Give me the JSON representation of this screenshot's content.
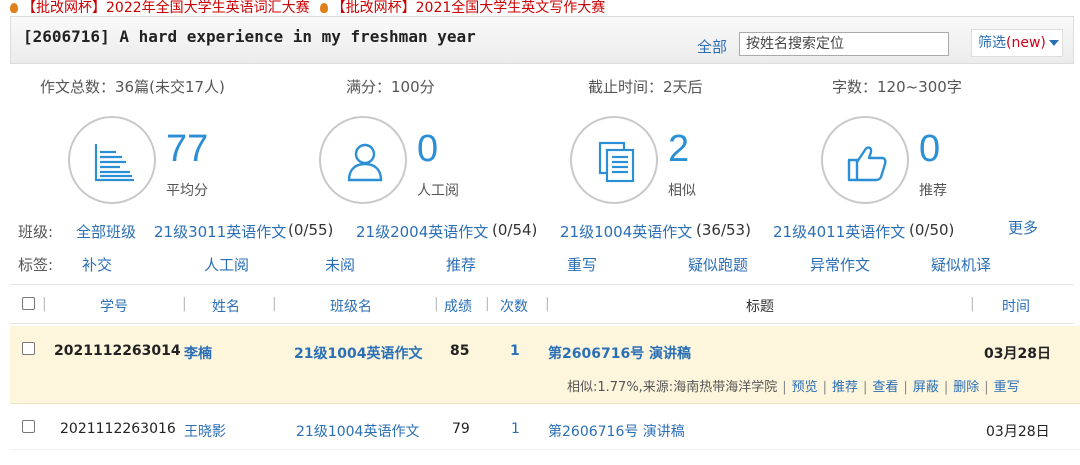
{
  "banner": {
    "item1": "【批改网杯】2022年全国大学生英语词汇大赛",
    "item2": "【批改网杯】2021全国大学生英文写作大赛"
  },
  "header": {
    "title": "[2606716] A hard experience in my freshman year",
    "all_link": "全部",
    "search_placeholder": "按姓名搜索定位",
    "filter_label": "筛选",
    "filter_new": "(new)"
  },
  "stats": {
    "total": "作文总数：36篇(未交17人)",
    "full_score": "满分：100分",
    "deadline": "截止时间：2天后",
    "words": "字数：120~300字"
  },
  "cards": [
    {
      "value": "77",
      "label": "平均分",
      "icon": "bar-chart-icon"
    },
    {
      "value": "0",
      "label": "人工阅",
      "icon": "person-icon"
    },
    {
      "value": "2",
      "label": "相似",
      "icon": "documents-icon"
    },
    {
      "value": "0",
      "label": "推荐",
      "icon": "thumbs-up-icon"
    }
  ],
  "classes": {
    "label": "班级:",
    "items": [
      "全部班级",
      "21级3011英语作文",
      "(0/55)",
      "21级2004英语作文",
      "(0/54)",
      "21级1004英语作文",
      "(36/53)",
      "21级4011英语作文",
      "(0/50)"
    ],
    "more": "更多"
  },
  "tags": {
    "label": "标签:",
    "items": [
      "补交",
      "人工阅",
      "未阅",
      "推荐",
      "重写",
      "疑似跑题",
      "异常作文",
      "疑似机译"
    ]
  },
  "table": {
    "headers": [
      "学号",
      "姓名",
      "班级名",
      "成绩",
      "次数",
      "标题",
      "时间"
    ],
    "rows": [
      {
        "id": "2021112263014",
        "name": "李楠",
        "class": "21级1004英语作文",
        "score": "85",
        "count": "1",
        "title": "第2606716号 演讲稿",
        "time": "03月28日",
        "detail": "相似:1.77%,来源:海南热带海洋学院",
        "actions": [
          "预览",
          "推荐",
          "查看",
          "屏蔽",
          "删除",
          "重写"
        ]
      },
      {
        "id": "2021112263016",
        "name": "王晓影",
        "class": "21级1004英语作文",
        "score": "79",
        "count": "1",
        "title": "第2606716号 演讲稿",
        "time": "03月28日"
      }
    ]
  },
  "colors": {
    "accent": "#2b8fd6",
    "link": "#2b6fb6",
    "highlight_row": "#fdf6dc",
    "banner_red": "#cc0000"
  }
}
